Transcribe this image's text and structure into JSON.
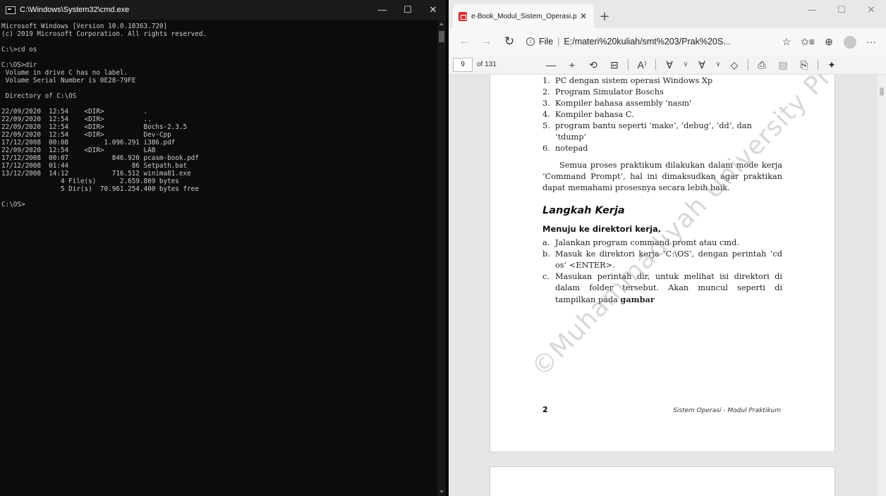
{
  "cmd": {
    "title": "C:\\Windows\\System32\\cmd.exe",
    "controls": {
      "minimize": "—",
      "maximize": "☐",
      "close": "✕"
    },
    "lines": [
      "Microsoft Windows [Version 10.0.18363.720]",
      "(c) 2019 Microsoft Corporation. All rights reserved.",
      "",
      "C:\\>cd os",
      "",
      "C:\\OS>dir",
      " Volume in drive C has no label.",
      " Volume Serial Number is 0E28-79FE",
      "",
      " Directory of C:\\OS",
      "",
      "22/09/2020  12:54    <DIR>          .",
      "22/09/2020  12:54    <DIR>          ..",
      "22/09/2020  12:54    <DIR>          Bochs-2.3.5",
      "22/09/2020  12:54    <DIR>          Dev-Cpp",
      "17/12/2008  00:08         1.096.291 i386.pdf",
      "22/09/2020  12:54    <DIR>          LAB",
      "17/12/2008  00:07           846.920 pcasm-book.pdf",
      "17/12/2008  01:44                86 Setpath.bat",
      "13/12/2008  14:12           716.512 winima81.exe",
      "               4 File(s)      2.659.809 bytes",
      "               5 Dir(s)  70.961.254.400 bytes free",
      "",
      "C:\\OS>"
    ]
  },
  "edge": {
    "tab": {
      "title": "e-Book_Modul_Sistem_Operasi.p",
      "close": "✕",
      "new_tab": "+"
    },
    "window_controls": {
      "minimize": "—",
      "maximize": "☐",
      "close": "✕"
    },
    "nav": {
      "back": "←",
      "forward": "→",
      "refresh": "↻"
    },
    "address": {
      "scheme": "File",
      "separator": "|",
      "url": "E:/materi%20kuliah/smt%203/Prak%20S..."
    },
    "toolbar_icons": {
      "favorite": "☆",
      "favorites_bar": "✩≡",
      "collections": "⊕",
      "more": "···"
    },
    "pdf_toolbar": {
      "page": "9",
      "of_pages": "of 131",
      "zoom_out": "—",
      "zoom_in": "+",
      "rotate": "⟲",
      "fit": "⊟",
      "read_aloud": "A⁾",
      "draw": "∀",
      "draw_chevron": "∨",
      "highlight": "∀",
      "highlight_chevron": "∨",
      "erase": "◇",
      "print": "⎙",
      "save": "▤",
      "save_as": "⎘",
      "pin": "✦"
    },
    "document": {
      "list": [
        {
          "num": "1.",
          "text": "PC dengan sistem operasi Windows Xp"
        },
        {
          "num": "2.",
          "text": "Program Simulator Boschs"
        },
        {
          "num": "3.",
          "text": "Kompiler bahasa assembly 'nasm'"
        },
        {
          "num": "4.",
          "text": "Kompiler bahasa C."
        },
        {
          "num": "5.",
          "text": "program bantu seperti ‘make’, ‘debug’, ‘dd’, dan ‘tdump’"
        },
        {
          "num": "6.",
          "text": "notepad"
        }
      ],
      "paragraph": "Semua proses praktikum dilakukan dalam mode kerja ‘Command Prompt’, hal ini dimaksudkan agar praktikan dapat memahami prosesnya secara lebih baik.",
      "section_title": "Langkah Kerja",
      "subsection_title": "Menuju ke direktori kerja.",
      "steps": [
        {
          "num": "a.",
          "text": "Jalankan program command promt atau cmd."
        },
        {
          "num": "b.",
          "text": "Masuk ke direktori kerja ‘C:\\OS’, dengan perintah ‘cd os’ <ENTER>."
        },
        {
          "num": "c.",
          "text": "Masukan perintah dir, untuk melihat isi direktori di dalam folder tersebut. Akan muncul seperti di tampilkan pada",
          "bold_tail": "gambar"
        }
      ],
      "page_number": "2",
      "footer_title": "Sistem Operasi - Modul Praktikum",
      "watermark": "©Muhammadiyah University Pr"
    }
  }
}
